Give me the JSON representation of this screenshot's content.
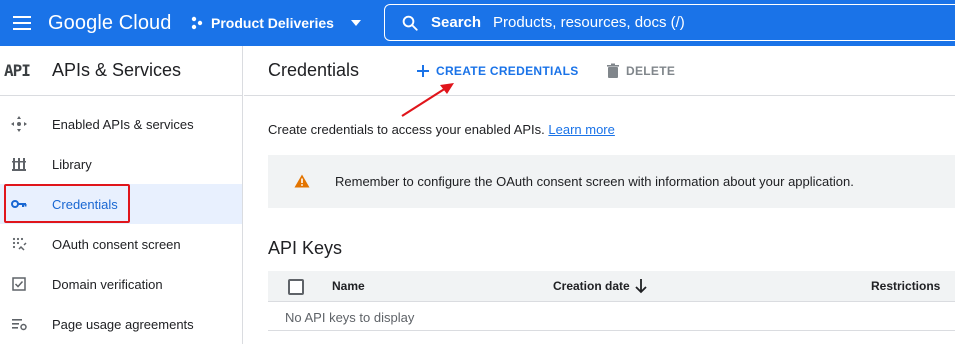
{
  "topbar": {
    "logo": "Google Cloud",
    "project": "Product Deliveries",
    "search_label": "Search",
    "search_placeholder": "Products, resources, docs (/)"
  },
  "sidebar": {
    "badge": "API",
    "title": "APIs & Services",
    "items": [
      {
        "label": "Enabled APIs & services",
        "icon": "hub-icon"
      },
      {
        "label": "Library",
        "icon": "library-icon"
      },
      {
        "label": "Credentials",
        "icon": "key-icon",
        "active": true
      },
      {
        "label": "OAuth consent screen",
        "icon": "consent-icon"
      },
      {
        "label": "Domain verification",
        "icon": "checkbox-icon"
      },
      {
        "label": "Page usage agreements",
        "icon": "settings-list-icon"
      }
    ]
  },
  "main": {
    "title": "Credentials",
    "create_label": "CREATE CREDENTIALS",
    "delete_label": "DELETE",
    "intro_text": "Create credentials to access your enabled APIs.",
    "learn_more": "Learn more",
    "notice_text": "Remember to configure the OAuth consent screen with information about your application.",
    "api_keys_title": "API Keys",
    "table": {
      "columns": [
        "Name",
        "Creation date",
        "Restrictions"
      ],
      "empty_text": "No API keys to display"
    }
  },
  "colors": {
    "brand": "#1a73e8",
    "active_bg": "#e8f0fe",
    "annotation": "#e0151b",
    "warning": "#e37400"
  }
}
